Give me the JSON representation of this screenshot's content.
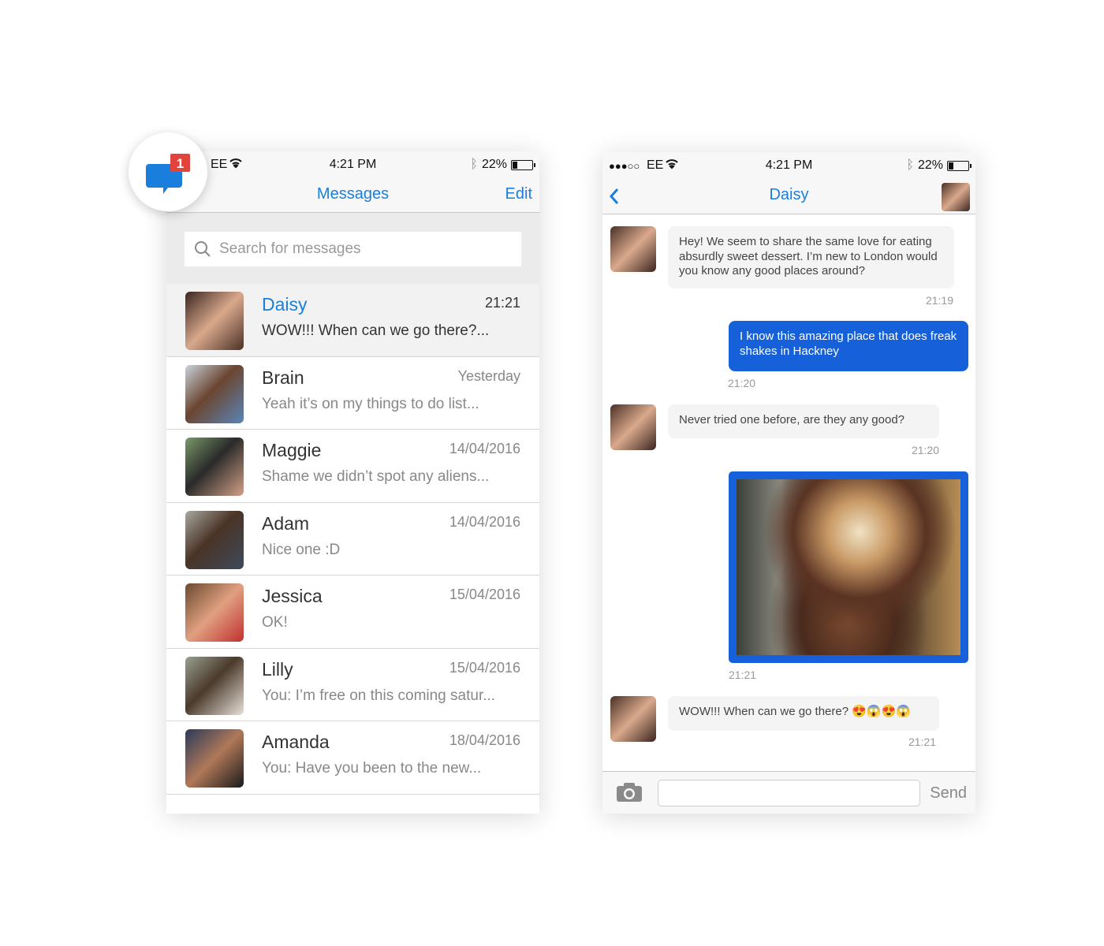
{
  "colors": {
    "accent": "#1a7fdc",
    "sent_bubble": "#1661d9",
    "badge": "#e0443c"
  },
  "app_icon": {
    "icon": "chat-bubble-icon",
    "badge_count": "1"
  },
  "list_screen": {
    "status": {
      "carrier": "EE",
      "time": "4:21 PM",
      "battery": "22%",
      "battery_level": 0.22
    },
    "nav": {
      "title": "Messages",
      "edit": "Edit"
    },
    "search": {
      "placeholder": "Search for messages"
    },
    "conversations": [
      {
        "name": "Daisy",
        "date": "21:21",
        "message": "WOW!!! When can we go there?...",
        "selected": true
      },
      {
        "name": "Brain",
        "date": "Yesterday",
        "message": "Yeah it’s on my things to do list..."
      },
      {
        "name": "Maggie",
        "date": "14/04/2016",
        "message": "Shame we didn’t spot any aliens..."
      },
      {
        "name": "Adam",
        "date": "14/04/2016",
        "message": "Nice one :D"
      },
      {
        "name": "Jessica",
        "date": "15/04/2016",
        "message": "OK!"
      },
      {
        "name": "Lilly",
        "date": "15/04/2016",
        "message": "You: I’m free on this coming satur..."
      },
      {
        "name": "Amanda",
        "date": "18/04/2016",
        "message": "You: Have you been to the new..."
      }
    ]
  },
  "chat_screen": {
    "status": {
      "signal": "●●●○○",
      "carrier": "EE",
      "time": "4:21 PM",
      "battery": "22%"
    },
    "nav": {
      "title": "Daisy"
    },
    "messages": [
      {
        "from": "Daisy",
        "text": "Hey! We seem to share the same love for eating absurdly sweet dessert. I’m new to London would you know any good places around?",
        "time": "21:19"
      },
      {
        "from": "me",
        "text": "I know this amazing place that does freak shakes in Hackney",
        "time": "21:20"
      },
      {
        "from": "Daisy",
        "text": "Never tried one before, are they any good?",
        "time": "21:20"
      },
      {
        "from": "me",
        "type": "image",
        "time": "21:21"
      },
      {
        "from": "Daisy",
        "text": "WOW!!! When can we go there? 😍😱😍😱",
        "time": "21:21"
      }
    ],
    "composer": {
      "value": "",
      "send": "Send"
    }
  }
}
